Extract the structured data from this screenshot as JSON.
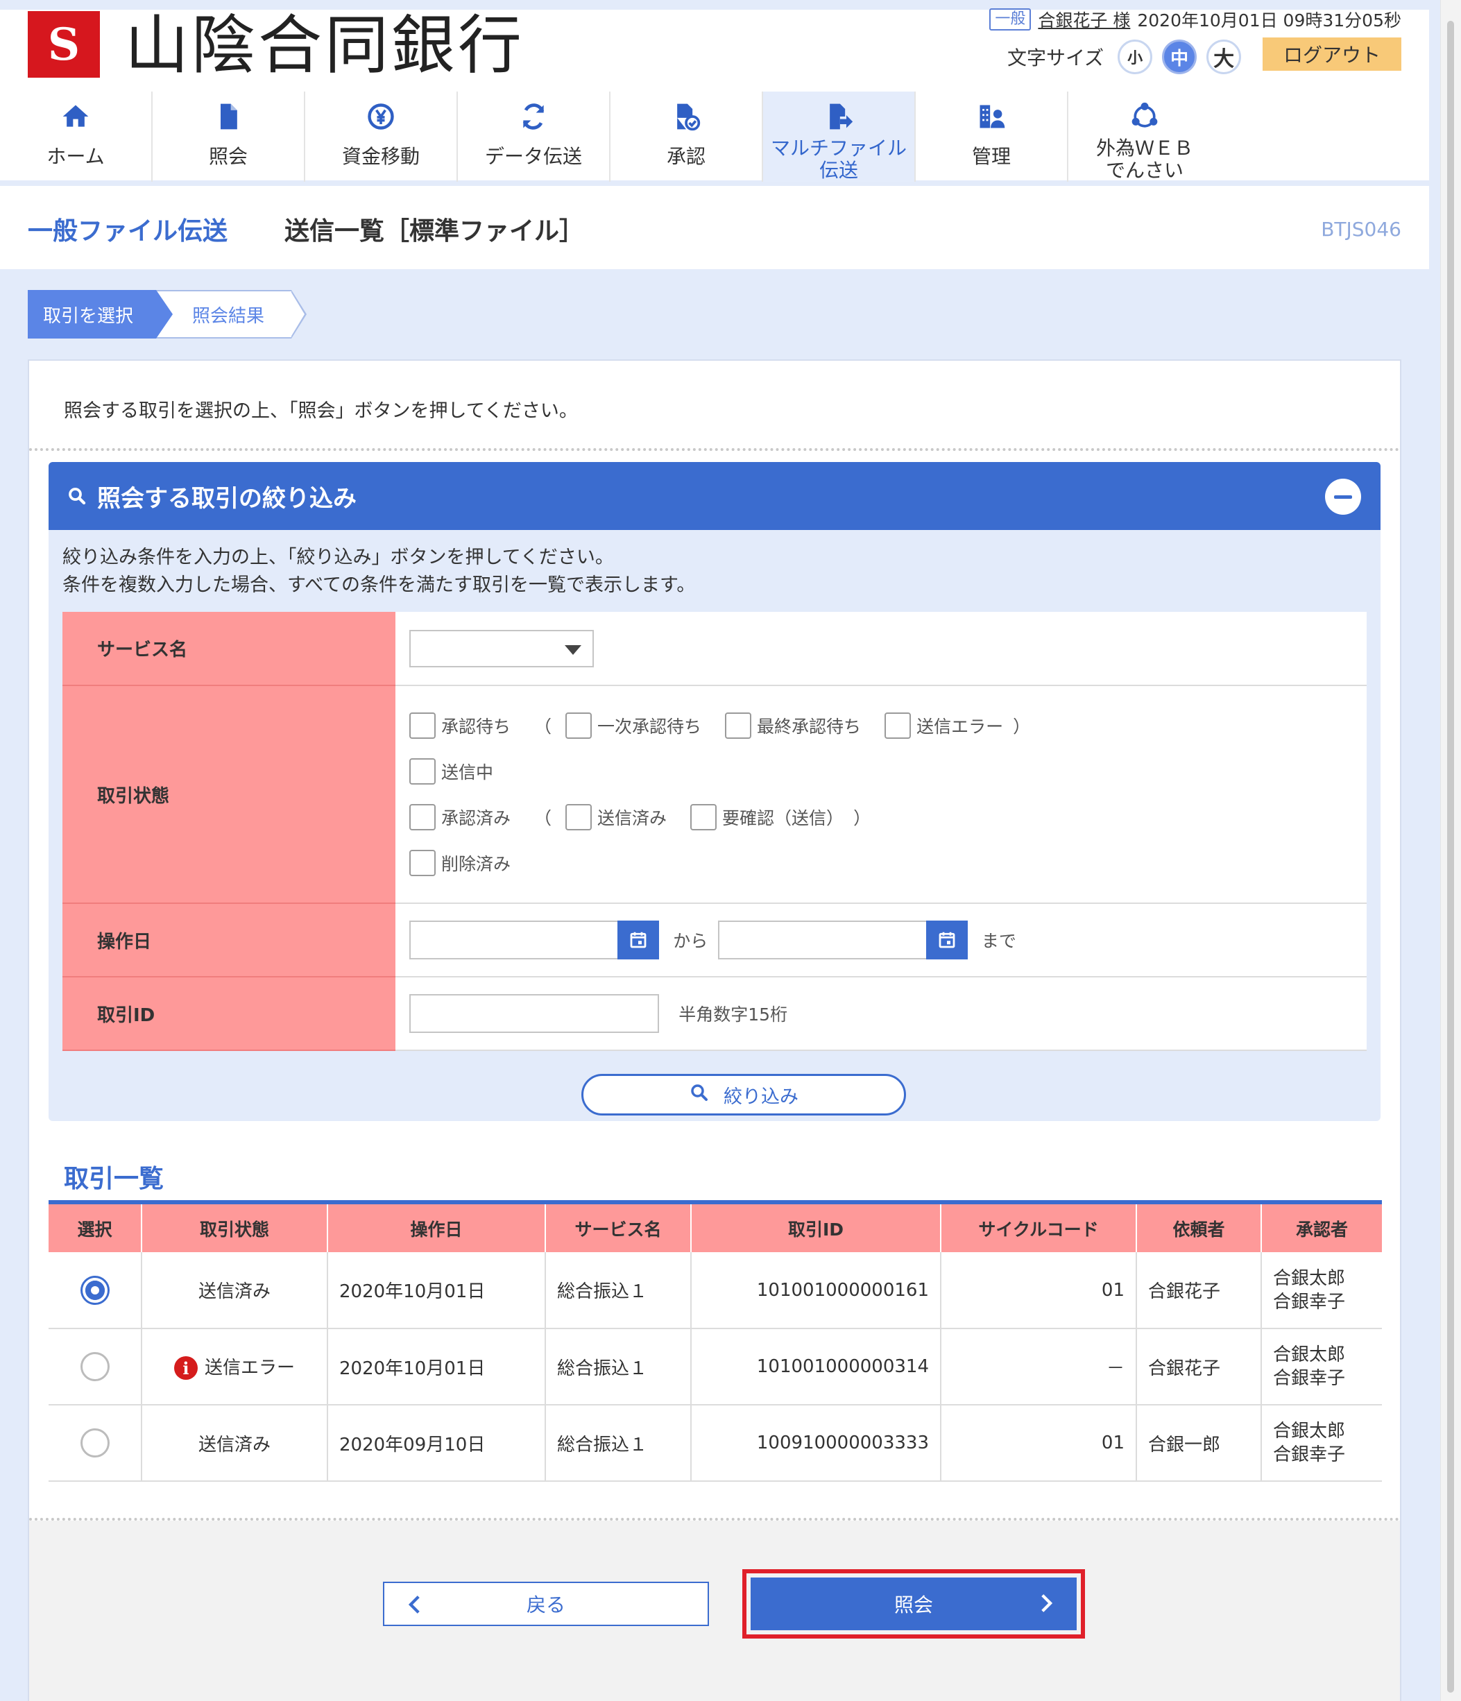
{
  "header": {
    "logo_text": "S",
    "bank_name": "山陰合同銀行",
    "user_badge": "一般",
    "user_name": "合銀花子 様",
    "datetime": "2020年10月01日 09時31分05秒",
    "font_size_label": "文字サイズ",
    "font_sizes": [
      "小",
      "中",
      "大"
    ],
    "font_size_selected": "中",
    "logout_label": "ログアウト"
  },
  "nav": {
    "items": [
      {
        "label": "ホーム",
        "icon": "home-icon"
      },
      {
        "label": "照会",
        "icon": "document-icon"
      },
      {
        "label": "資金移動",
        "icon": "yen-transfer-icon"
      },
      {
        "label": "データ伝送",
        "icon": "sync-icon"
      },
      {
        "label": "承認",
        "icon": "approve-document-icon"
      },
      {
        "label": "マルチファイル\n伝送",
        "icon": "file-transfer-icon",
        "active": true
      },
      {
        "label": "管理",
        "icon": "management-icon"
      },
      {
        "label": "外為ＷＥＢ\nでんさい",
        "icon": "network-icon"
      }
    ]
  },
  "title": {
    "category": "一般ファイル伝送",
    "page": "送信一覧［標準ファイル］",
    "screen_code": "BTJS046"
  },
  "steps": [
    "取引を選択",
    "照会結果"
  ],
  "intro": "照会する取引を選択の上、「照会」ボタンを押してください。",
  "filter": {
    "title": "照会する取引の絞り込み",
    "description_1": "絞り込み条件を入力の上、「絞り込み」ボタンを押してください。",
    "description_2": "条件を複数入力した場合、すべての条件を満たす取引を一覧で表示します。",
    "service_label": "サービス名",
    "service_value": "",
    "status_label": "取引状態",
    "status_options": {
      "pending": "承認待ち",
      "first_pending": "一次承認待ち",
      "final_pending": "最終承認待ち",
      "send_error": "送信エラー",
      "sending": "送信中",
      "approved": "承認済み",
      "sent": "送信済み",
      "needs_check": "要確認（送信）",
      "deleted": "削除済み",
      "open_paren": "（",
      "close_paren": "）"
    },
    "date_label": "操作日",
    "date_from_suffix": "から",
    "date_to_suffix": "まで",
    "id_label": "取引ID",
    "id_hint": "半角数字15桁",
    "button_label": "絞り込み"
  },
  "list": {
    "title": "取引一覧",
    "columns": [
      "選択",
      "取引状態",
      "操作日",
      "サービス名",
      "取引ID",
      "サイクルコード",
      "依頼者",
      "承認者"
    ],
    "rows": [
      {
        "selected": true,
        "status": "送信済み",
        "error": false,
        "date": "2020年10月01日",
        "service": "総合振込１",
        "id": "101001000000161",
        "cycle": "01",
        "requester": "合銀花子",
        "approver1": "合銀太郎",
        "approver2": "合銀幸子"
      },
      {
        "selected": false,
        "status": "送信エラー",
        "error": true,
        "date": "2020年10月01日",
        "service": "総合振込１",
        "id": "101001000000314",
        "cycle": "－",
        "requester": "合銀花子",
        "approver1": "合銀太郎",
        "approver2": "合銀幸子"
      },
      {
        "selected": false,
        "status": "送信済み",
        "error": false,
        "date": "2020年09月10日",
        "service": "総合振込１",
        "id": "100910000003333",
        "cycle": "01",
        "requester": "合銀一郎",
        "approver1": "合銀太郎",
        "approver2": "合銀幸子"
      }
    ]
  },
  "buttons": {
    "back": "戻る",
    "submit": "照会"
  },
  "colors": {
    "accent": "#3b6ccf",
    "header_pink": "#fe9999",
    "logout": "#f8c978",
    "highlight": "#e0202a"
  }
}
